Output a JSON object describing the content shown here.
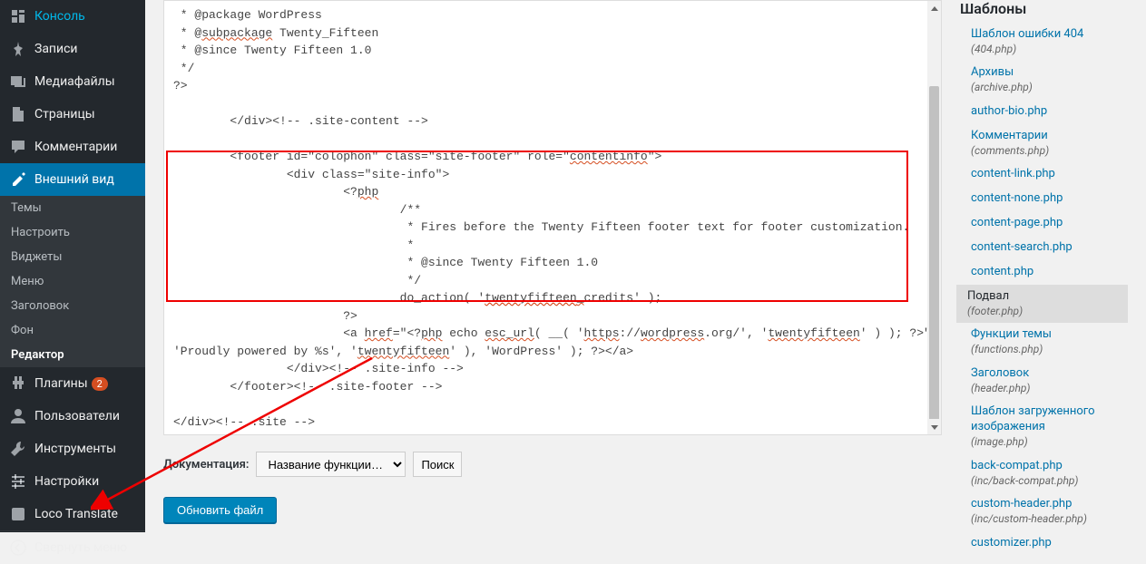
{
  "sidebar": {
    "items": [
      {
        "icon": "dashboard",
        "label": "Консоль"
      },
      {
        "icon": "pin",
        "label": "Записи"
      },
      {
        "icon": "media",
        "label": "Медиафайлы"
      },
      {
        "icon": "page",
        "label": "Страницы"
      },
      {
        "icon": "comment",
        "label": "Комментарии"
      },
      {
        "icon": "appearance",
        "label": "Внешний вид",
        "current": true
      },
      {
        "icon": "plugin",
        "label": "Плагины",
        "badge": "2"
      },
      {
        "icon": "user",
        "label": "Пользователи"
      },
      {
        "icon": "tool",
        "label": "Инструменты"
      },
      {
        "icon": "settings",
        "label": "Настройки"
      },
      {
        "icon": "loco",
        "label": "Loco Translate"
      },
      {
        "icon": "collapse",
        "label": "Свернуть меню"
      }
    ],
    "submenu": [
      "Темы",
      "Настроить",
      "Виджеты",
      "Меню",
      "Заголовок",
      "Фон",
      "Редактор"
    ],
    "submenu_current": 6
  },
  "code": " * @package WordPress\n * @subpackage Twenty_Fifteen\n * @since Twenty Fifteen 1.0\n */\n?>\n\n\t</div><!-- .site-content -->\n\n\t<footer id=\"colophon\" class=\"site-footer\" role=\"contentinfo\">\n\t\t<div class=\"site-info\">\n\t\t\t<?php\n\t\t\t\t/**\n\t\t\t\t * Fires before the Twenty Fifteen footer text for footer customization.\n\t\t\t\t *\n\t\t\t\t * @since Twenty Fifteen 1.0\n\t\t\t\t */\n\t\t\t\tdo_action( 'twentyfifteen_credits' );\n\t\t\t?>\n\t\t\t<a href=\"<?php echo esc_url( __( 'https://wordpress.org/', 'twentyfifteen' ) ); ?>\"><?php printf( __( \n'Proudly powered by %s', 'twentyfifteen' ), 'WordPress' ); ?></a>\n\t\t</div><!-- .site-info -->\n\t</footer><!-- .site-footer -->\n\n</div><!-- .site -->\n\n<?php wp_footer(); ?>\n\n</body>\n</html>",
  "doc": {
    "label": "Документация:",
    "select_placeholder": "Название функции…",
    "search": "Поиск"
  },
  "update_btn": "Обновить файл",
  "templates": {
    "heading": "Шаблоны",
    "list": [
      {
        "label": "Шаблон ошибки 404",
        "sub": "(404.php)"
      },
      {
        "label": "Архивы",
        "sub": "(archive.php)"
      },
      {
        "label": "author-bio.php"
      },
      {
        "label": "Комментарии",
        "sub": "(comments.php)"
      },
      {
        "label": "content-link.php"
      },
      {
        "label": "content-none.php"
      },
      {
        "label": "content-page.php"
      },
      {
        "label": "content-search.php"
      },
      {
        "label": "content.php"
      },
      {
        "label": "Подвал",
        "sub": "(footer.php)",
        "active": true
      },
      {
        "label": "Функции темы",
        "sub": "(functions.php)"
      },
      {
        "label": "Заголовок",
        "sub": "(header.php)"
      },
      {
        "label": "Шаблон загруженного изображения",
        "sub": "(image.php)"
      },
      {
        "label": "back-compat.php",
        "sub": "(inc/back-compat.php)"
      },
      {
        "label": "custom-header.php",
        "sub": "(inc/custom-header.php)"
      },
      {
        "label": "customizer.php"
      }
    ]
  }
}
